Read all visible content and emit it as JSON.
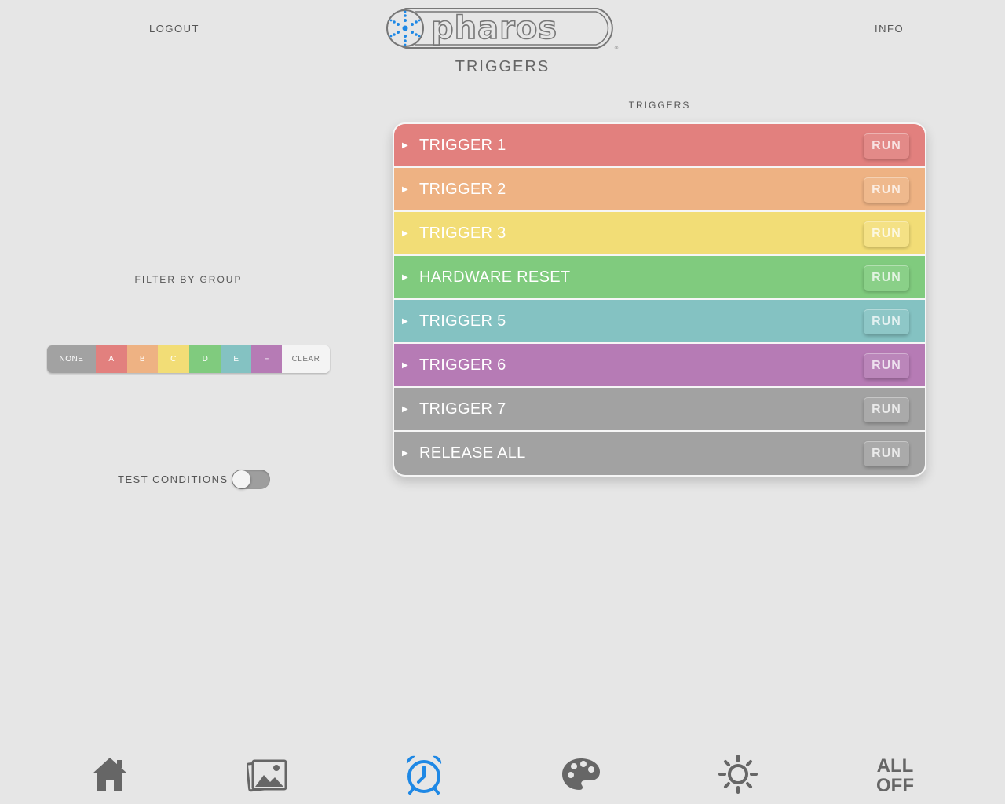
{
  "header": {
    "logout_label": "LOGOUT",
    "info_label": "INFO",
    "logo_text": "pharos",
    "page_title": "TRIGGERS"
  },
  "filter": {
    "heading": "FILTER BY GROUP",
    "segments": [
      "NONE",
      "A",
      "B",
      "C",
      "D",
      "E",
      "F",
      "CLEAR"
    ]
  },
  "test_conditions": {
    "label": "TEST CONDITIONS",
    "enabled": false
  },
  "triggers": {
    "heading": "TRIGGERS",
    "run_label": "RUN",
    "items": [
      {
        "name": "TRIGGER 1",
        "color": "#e2807e",
        "button_color": "#e38a88"
      },
      {
        "name": "TRIGGER 2",
        "color": "#eeb283",
        "button_color": "#efb98d"
      },
      {
        "name": "TRIGGER 3",
        "color": "#f2dd76",
        "button_color": "#f4e185"
      },
      {
        "name": "HARDWARE RESET",
        "color": "#80cb7e",
        "button_color": "#8ad088"
      },
      {
        "name": "TRIGGER 5",
        "color": "#84c2c2",
        "button_color": "#8ec7c7"
      },
      {
        "name": "TRIGGER 6",
        "color": "#b67bb5",
        "button_color": "#bb86ba"
      },
      {
        "name": "TRIGGER 7",
        "color": "#a2a2a2",
        "button_color": "#aaaaaa"
      },
      {
        "name": "RELEASE ALL",
        "color": "#a2a2a2",
        "button_color": "#aaaaaa"
      }
    ]
  },
  "nav": {
    "items": [
      {
        "id": "home",
        "icon": "home-icon"
      },
      {
        "id": "scenes",
        "icon": "images-icon"
      },
      {
        "id": "triggers",
        "icon": "alarm-clock-icon",
        "active": true
      },
      {
        "id": "color",
        "icon": "palette-icon"
      },
      {
        "id": "brightness",
        "icon": "sun-icon"
      }
    ],
    "all_off_line1": "ALL",
    "all_off_line2": "OFF"
  },
  "colors": {
    "background": "#e6e6e6",
    "accent_blue": "#1e88e5",
    "nav_icon": "#666666"
  }
}
